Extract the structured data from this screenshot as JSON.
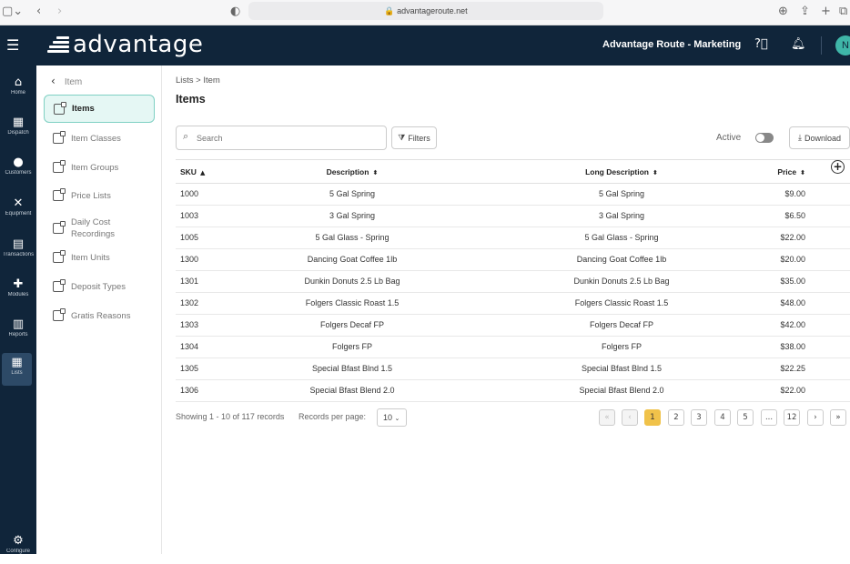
{
  "browser": {
    "url": "advantageroute.net"
  },
  "header": {
    "logo_text": "advantage",
    "company": "Advantage Route - Marketing",
    "avatar_initial": "N"
  },
  "leftnav": {
    "items": [
      {
        "label": "Home",
        "icon": "home-icon"
      },
      {
        "label": "Dispatch",
        "icon": "calendar-icon"
      },
      {
        "label": "Customers",
        "icon": "person-icon"
      },
      {
        "label": "Equipment",
        "icon": "wrench-icon"
      },
      {
        "label": "Transactions",
        "icon": "document-icon"
      },
      {
        "label": "Modules",
        "icon": "puzzle-icon"
      },
      {
        "label": "Reports",
        "icon": "report-icon"
      },
      {
        "label": "Lists",
        "icon": "list-icon"
      },
      {
        "label": "Configure",
        "icon": "gear-icon"
      }
    ]
  },
  "subnav": {
    "back_label": "Item",
    "items": [
      {
        "label": "Items"
      },
      {
        "label": "Item Classes"
      },
      {
        "label": "Item Groups"
      },
      {
        "label": "Price Lists"
      },
      {
        "label": "Daily Cost Recordings"
      },
      {
        "label": "Item Units"
      },
      {
        "label": "Deposit Types"
      },
      {
        "label": "Gratis Reasons"
      }
    ]
  },
  "main": {
    "breadcrumb": "Lists  >  Item",
    "title": "Items",
    "search_placeholder": "Search",
    "filters_label": "Filters",
    "active_label": "Active",
    "download_label": "Download"
  },
  "table": {
    "headers": {
      "sku": "SKU",
      "description": "Description",
      "long_description": "Long Description",
      "price": "Price"
    },
    "rows": [
      {
        "sku": "1000",
        "description": "5 Gal Spring",
        "long_description": "5 Gal Spring",
        "price": "$9.00"
      },
      {
        "sku": "1003",
        "description": "3 Gal Spring",
        "long_description": "3 Gal Spring",
        "price": "$6.50"
      },
      {
        "sku": "1005",
        "description": "5 Gal Glass - Spring",
        "long_description": "5 Gal Glass - Spring",
        "price": "$22.00"
      },
      {
        "sku": "1300",
        "description": "Dancing Goat Coffee 1lb",
        "long_description": "Dancing Goat Coffee 1lb",
        "price": "$20.00"
      },
      {
        "sku": "1301",
        "description": "Dunkin Donuts 2.5 Lb Bag",
        "long_description": "Dunkin Donuts 2.5 Lb Bag",
        "price": "$35.00"
      },
      {
        "sku": "1302",
        "description": "Folgers Classic Roast 1.5",
        "long_description": "Folgers Classic Roast 1.5",
        "price": "$48.00"
      },
      {
        "sku": "1303",
        "description": "Folgers Decaf FP",
        "long_description": "Folgers Decaf FP",
        "price": "$42.00"
      },
      {
        "sku": "1304",
        "description": "Folgers FP",
        "long_description": "Folgers FP",
        "price": "$38.00"
      },
      {
        "sku": "1305",
        "description": "Special Bfast Blnd 1.5",
        "long_description": "Special Bfast Blnd 1.5",
        "price": "$22.25"
      },
      {
        "sku": "1306",
        "description": "Special Bfast Blend 2.0",
        "long_description": "Special Bfast Blend 2.0",
        "price": "$22.00"
      }
    ]
  },
  "pagination": {
    "showing": "Showing 1 - 10 of 117 records",
    "per_page_label": "Records per page:",
    "per_page_value": "10",
    "pages": [
      "1",
      "2",
      "3",
      "4",
      "5",
      "...",
      "12"
    ],
    "current_page": "1"
  }
}
